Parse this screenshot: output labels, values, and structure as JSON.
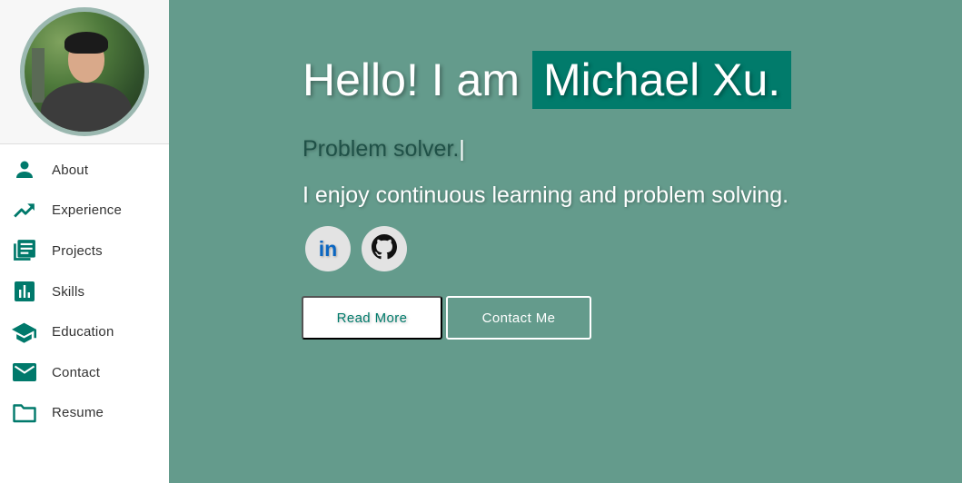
{
  "sidebar": {
    "items": [
      {
        "label": "About",
        "icon": "person-icon"
      },
      {
        "label": "Experience",
        "icon": "trending-up-icon"
      },
      {
        "label": "Projects",
        "icon": "library-books-icon"
      },
      {
        "label": "Skills",
        "icon": "bar-chart-icon"
      },
      {
        "label": "Education",
        "icon": "graduation-cap-icon"
      },
      {
        "label": "Contact",
        "icon": "mail-icon"
      },
      {
        "label": "Resume",
        "icon": "folder-icon"
      }
    ]
  },
  "hero": {
    "greeting": "Hello! I am",
    "name": "Michael Xu.",
    "typed_text": "Problem solver.",
    "cursor": "|",
    "tagline": "I enjoy continuous learning and problem solving."
  },
  "socials": {
    "linkedin_label": "in"
  },
  "buttons": {
    "read_more": "Read More",
    "contact_me": "Contact Me"
  },
  "colors": {
    "accent": "#017b6b",
    "background": "#649b8c",
    "sidebar_icon": "#00796b"
  }
}
